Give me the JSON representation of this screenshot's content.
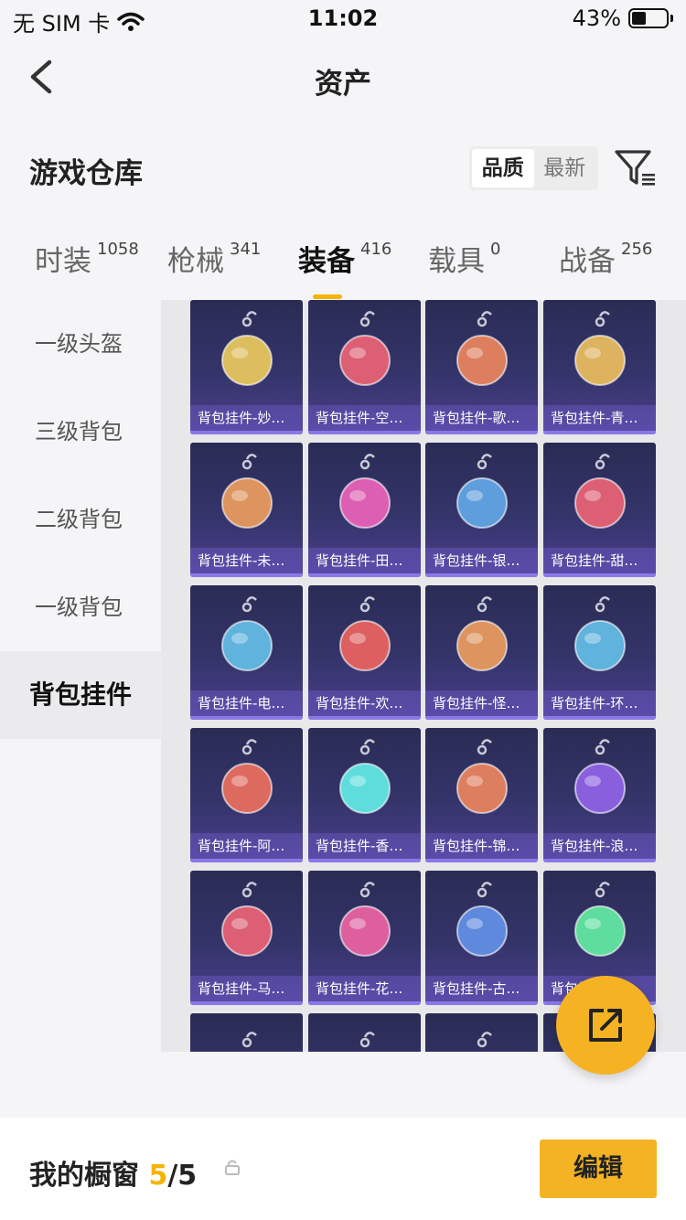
{
  "status_bar": {
    "carrier": "无 SIM 卡",
    "time": "11:02",
    "battery": "43%",
    "battery_level": 0.43
  },
  "nav": {
    "title": "资产"
  },
  "section": {
    "title": "游戏仓库"
  },
  "sort": {
    "options": [
      "品质",
      "最新"
    ],
    "active": "品质"
  },
  "tabs": [
    {
      "label": "时装",
      "count": "1058"
    },
    {
      "label": "枪械",
      "count": "341"
    },
    {
      "label": "装备",
      "count": "416"
    },
    {
      "label": "载具",
      "count": "0"
    },
    {
      "label": "战备",
      "count": "256"
    }
  ],
  "sidebar": {
    "items": [
      "一级头盔",
      "三级背包",
      "二级背包",
      "一级背包",
      "背包挂件"
    ]
  },
  "items": [
    {
      "name": "背包挂件-妙…",
      "icon": "flower-charm-icon"
    },
    {
      "name": "背包挂件-空…",
      "icon": "helmet-charm-icon"
    },
    {
      "name": "背包挂件-歌…",
      "icon": "chick-charm-icon"
    },
    {
      "name": "背包挂件-青…",
      "icon": "dragon-charm-icon"
    },
    {
      "name": "背包挂件-未…",
      "icon": "medallion-charm-icon"
    },
    {
      "name": "背包挂件-田…",
      "icon": "card-charm-icon"
    },
    {
      "name": "背包挂件-银…",
      "icon": "phone-charm-icon"
    },
    {
      "name": "背包挂件-甜…",
      "icon": "lollipop-charm-icon"
    },
    {
      "name": "背包挂件-电…",
      "icon": "gamepad-charm-icon"
    },
    {
      "name": "背包挂件-欢…",
      "icon": "mahjong-charm-icon"
    },
    {
      "name": "背包挂件-怪…",
      "icon": "pumpkin-charm-icon"
    },
    {
      "name": "背包挂件-环…",
      "icon": "ring-charm-icon"
    },
    {
      "name": "背包挂件-阿…",
      "icon": "fox-charm-icon"
    },
    {
      "name": "背包挂件-香…",
      "icon": "cocktail-charm-icon"
    },
    {
      "name": "背包挂件-锦…",
      "icon": "koi-charm-icon"
    },
    {
      "name": "背包挂件-浪…",
      "icon": "witch-charm-icon"
    },
    {
      "name": "背包挂件-马…",
      "icon": "macaron-charm-icon"
    },
    {
      "name": "背包挂件-花…",
      "icon": "amulet-charm-icon"
    },
    {
      "name": "背包挂件-古…",
      "icon": "bat-dragon-charm-icon"
    },
    {
      "name": "背包挂件-…",
      "icon": "jade-charm-icon"
    }
  ],
  "showcase": {
    "label": "我的橱窗",
    "used": "5",
    "total": "/5"
  },
  "edit_button": {
    "label": "编辑"
  },
  "colors": {
    "accent": "#f4b400",
    "card_top": "#2a2c55",
    "card_bottom": "#4b3f8e"
  }
}
